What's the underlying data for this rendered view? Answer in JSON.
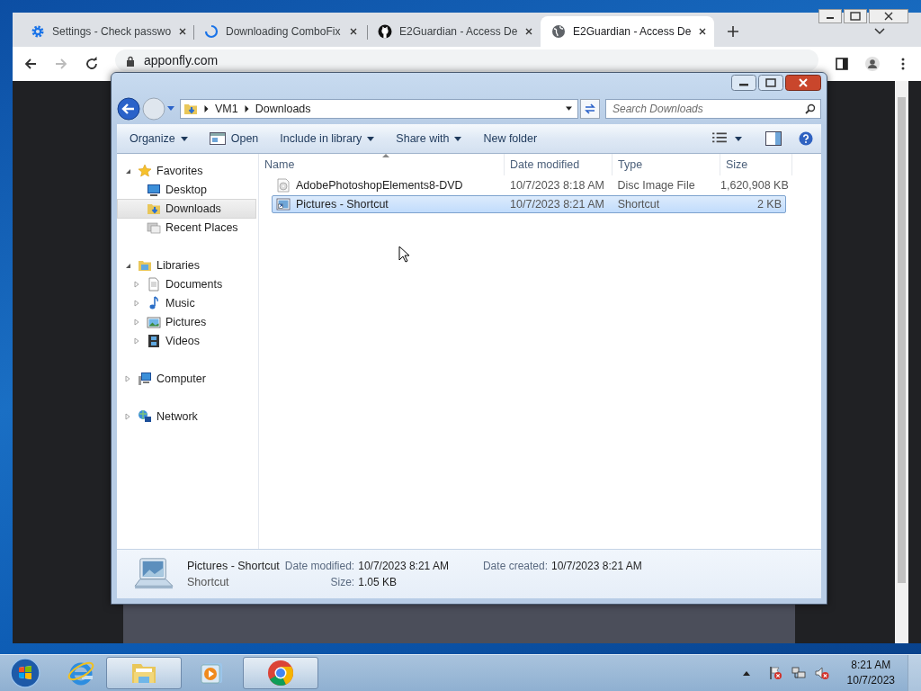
{
  "browser": {
    "tabs": [
      {
        "title": "Settings - Check passwo",
        "kind": "gear",
        "selected": false
      },
      {
        "title": "Downloading ComboFix",
        "kind": "spinner",
        "selected": false
      },
      {
        "title": "E2Guardian - Access De",
        "kind": "github",
        "selected": false
      },
      {
        "title": "E2Guardian - Access De",
        "kind": "globe",
        "selected": true
      }
    ],
    "url": "apponfly.com"
  },
  "explorer": {
    "breadcrumb": [
      "VM1",
      "Downloads"
    ],
    "search": {
      "placeholder": "Search Downloads"
    },
    "toolbar": [
      {
        "label": "Organize",
        "dropdown": true,
        "kind": "text"
      },
      {
        "label": "Open",
        "dropdown": false,
        "kind": "open"
      },
      {
        "label": "Include in library",
        "dropdown": true,
        "kind": "text"
      },
      {
        "label": "Share with",
        "dropdown": true,
        "kind": "text"
      },
      {
        "label": "New folder",
        "dropdown": false,
        "kind": "text"
      }
    ],
    "sidebar": [
      {
        "label": "Favorites",
        "kind": "star",
        "expanded": true,
        "selected": false,
        "children": [
          {
            "label": "Desktop",
            "kind": "desktop",
            "selected": false
          },
          {
            "label": "Downloads",
            "kind": "downloads",
            "selected": true
          },
          {
            "label": "Recent Places",
            "kind": "recent",
            "selected": false
          }
        ]
      },
      {
        "label": "Libraries",
        "kind": "libraries",
        "expanded": true,
        "selected": false,
        "children": [
          {
            "label": "Documents",
            "kind": "documents",
            "expanded": false,
            "selected": false
          },
          {
            "label": "Music",
            "kind": "music",
            "expanded": false,
            "selected": false
          },
          {
            "label": "Pictures",
            "kind": "pictures",
            "expanded": false,
            "selected": false
          },
          {
            "label": "Videos",
            "kind": "videos",
            "expanded": false,
            "selected": false
          }
        ]
      },
      {
        "label": "Computer",
        "kind": "computer",
        "expanded": false,
        "selected": false
      },
      {
        "label": "Network",
        "kind": "network",
        "expanded": false,
        "selected": false
      }
    ],
    "columns": [
      "Name",
      "Date modified",
      "Type",
      "Size"
    ],
    "files": [
      {
        "name": "AdobePhotoshopElements8-DVD",
        "kind": "disc",
        "date": "10/7/2023 8:18 AM",
        "type": "Disc Image File",
        "size": "1,620,908 KB",
        "selected": false
      },
      {
        "name": "Pictures - Shortcut",
        "kind": "shortcut",
        "date": "10/7/2023 8:21 AM",
        "type": "Shortcut",
        "size": "2 KB",
        "selected": true
      }
    ],
    "details": {
      "name": "Pictures - Shortcut",
      "type": "Shortcut",
      "rows": [
        [
          {
            "label": "Date modified:",
            "value": "10/7/2023 8:21 AM"
          },
          {
            "label": "Date created:",
            "value": "10/7/2023 8:21 AM"
          }
        ],
        [
          {
            "label": "Size:",
            "value": "1.05 KB"
          }
        ]
      ]
    }
  },
  "taskbar": {
    "apps": [
      {
        "kind": "ie",
        "active": false
      },
      {
        "kind": "explorer",
        "active": true
      },
      {
        "kind": "media",
        "active": false
      },
      {
        "kind": "chrome",
        "active": true
      }
    ],
    "clock": {
      "time": "8:21 AM",
      "date": "10/7/2023"
    }
  }
}
